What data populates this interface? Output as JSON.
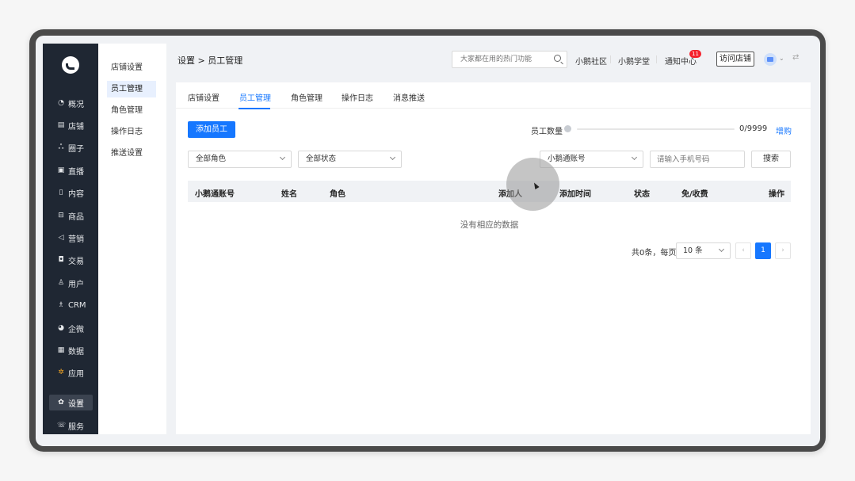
{
  "nav": {
    "items": [
      {
        "icon": "chart-pie-icon",
        "glyph": "◔",
        "label": "概况"
      },
      {
        "icon": "shop-icon",
        "glyph": "▤",
        "label": "店铺"
      },
      {
        "icon": "users-group-icon",
        "glyph": "ஃ",
        "label": "圈子"
      },
      {
        "icon": "live-video-icon",
        "glyph": "▣",
        "label": "直播"
      },
      {
        "icon": "document-icon",
        "glyph": "▯",
        "label": "内容"
      },
      {
        "icon": "product-icon",
        "glyph": "⊟",
        "label": "商品"
      },
      {
        "icon": "megaphone-icon",
        "glyph": "◁",
        "label": "营销"
      },
      {
        "icon": "trade-icon",
        "glyph": "◘",
        "label": "交易"
      },
      {
        "icon": "user-icon",
        "glyph": "♙",
        "label": "用户"
      },
      {
        "icon": "crm-icon",
        "glyph": "♗",
        "label": "CRM"
      },
      {
        "icon": "wecom-icon",
        "glyph": "◕",
        "label": "企微"
      },
      {
        "icon": "data-icon",
        "glyph": "▦",
        "label": "数据"
      },
      {
        "icon": "apps-icon",
        "glyph": "✲",
        "label": "应用"
      },
      {
        "icon": "settings-icon",
        "glyph": "✿",
        "label": "设置"
      },
      {
        "icon": "service-icon",
        "glyph": "☏",
        "label": "服务"
      }
    ]
  },
  "subnav": {
    "items": [
      "店铺设置",
      "员工管理",
      "角色管理",
      "操作日志",
      "推送设置"
    ]
  },
  "header": {
    "breadcrumb": "设置 > 员工管理",
    "search_placeholder": "大家都在用的热门功能",
    "links": [
      "小鹅社区",
      "小鹅学堂",
      "通知中心"
    ],
    "notice_badge": "11",
    "visit_store": "访问店铺"
  },
  "tabs": [
    "店铺设置",
    "员工管理",
    "角色管理",
    "操作日志",
    "消息推送"
  ],
  "toolbar": {
    "add_employee": "添加员工",
    "count_label": "员工数量",
    "count_value": "0/9999",
    "count_fraction": 0,
    "expand": "增购"
  },
  "filters": {
    "role": "全部角色",
    "status": "全部状态",
    "account_type": "小鹅通账号",
    "phone_placeholder": "请输入手机号码",
    "search": "搜索"
  },
  "table": {
    "headers": [
      "小鹅通账号",
      "姓名",
      "角色",
      "添加人",
      "添加时间",
      "状态",
      "免/收费",
      "操作"
    ],
    "empty_text": "没有相应的数据"
  },
  "pagination": {
    "total": "共0条，每页",
    "page_size": "10 条",
    "prev": "‹",
    "current": "1",
    "next": "›"
  },
  "colors": {
    "primary": "#1677ff",
    "nav_bg": "#1f2733",
    "badge": "#f5222d"
  }
}
